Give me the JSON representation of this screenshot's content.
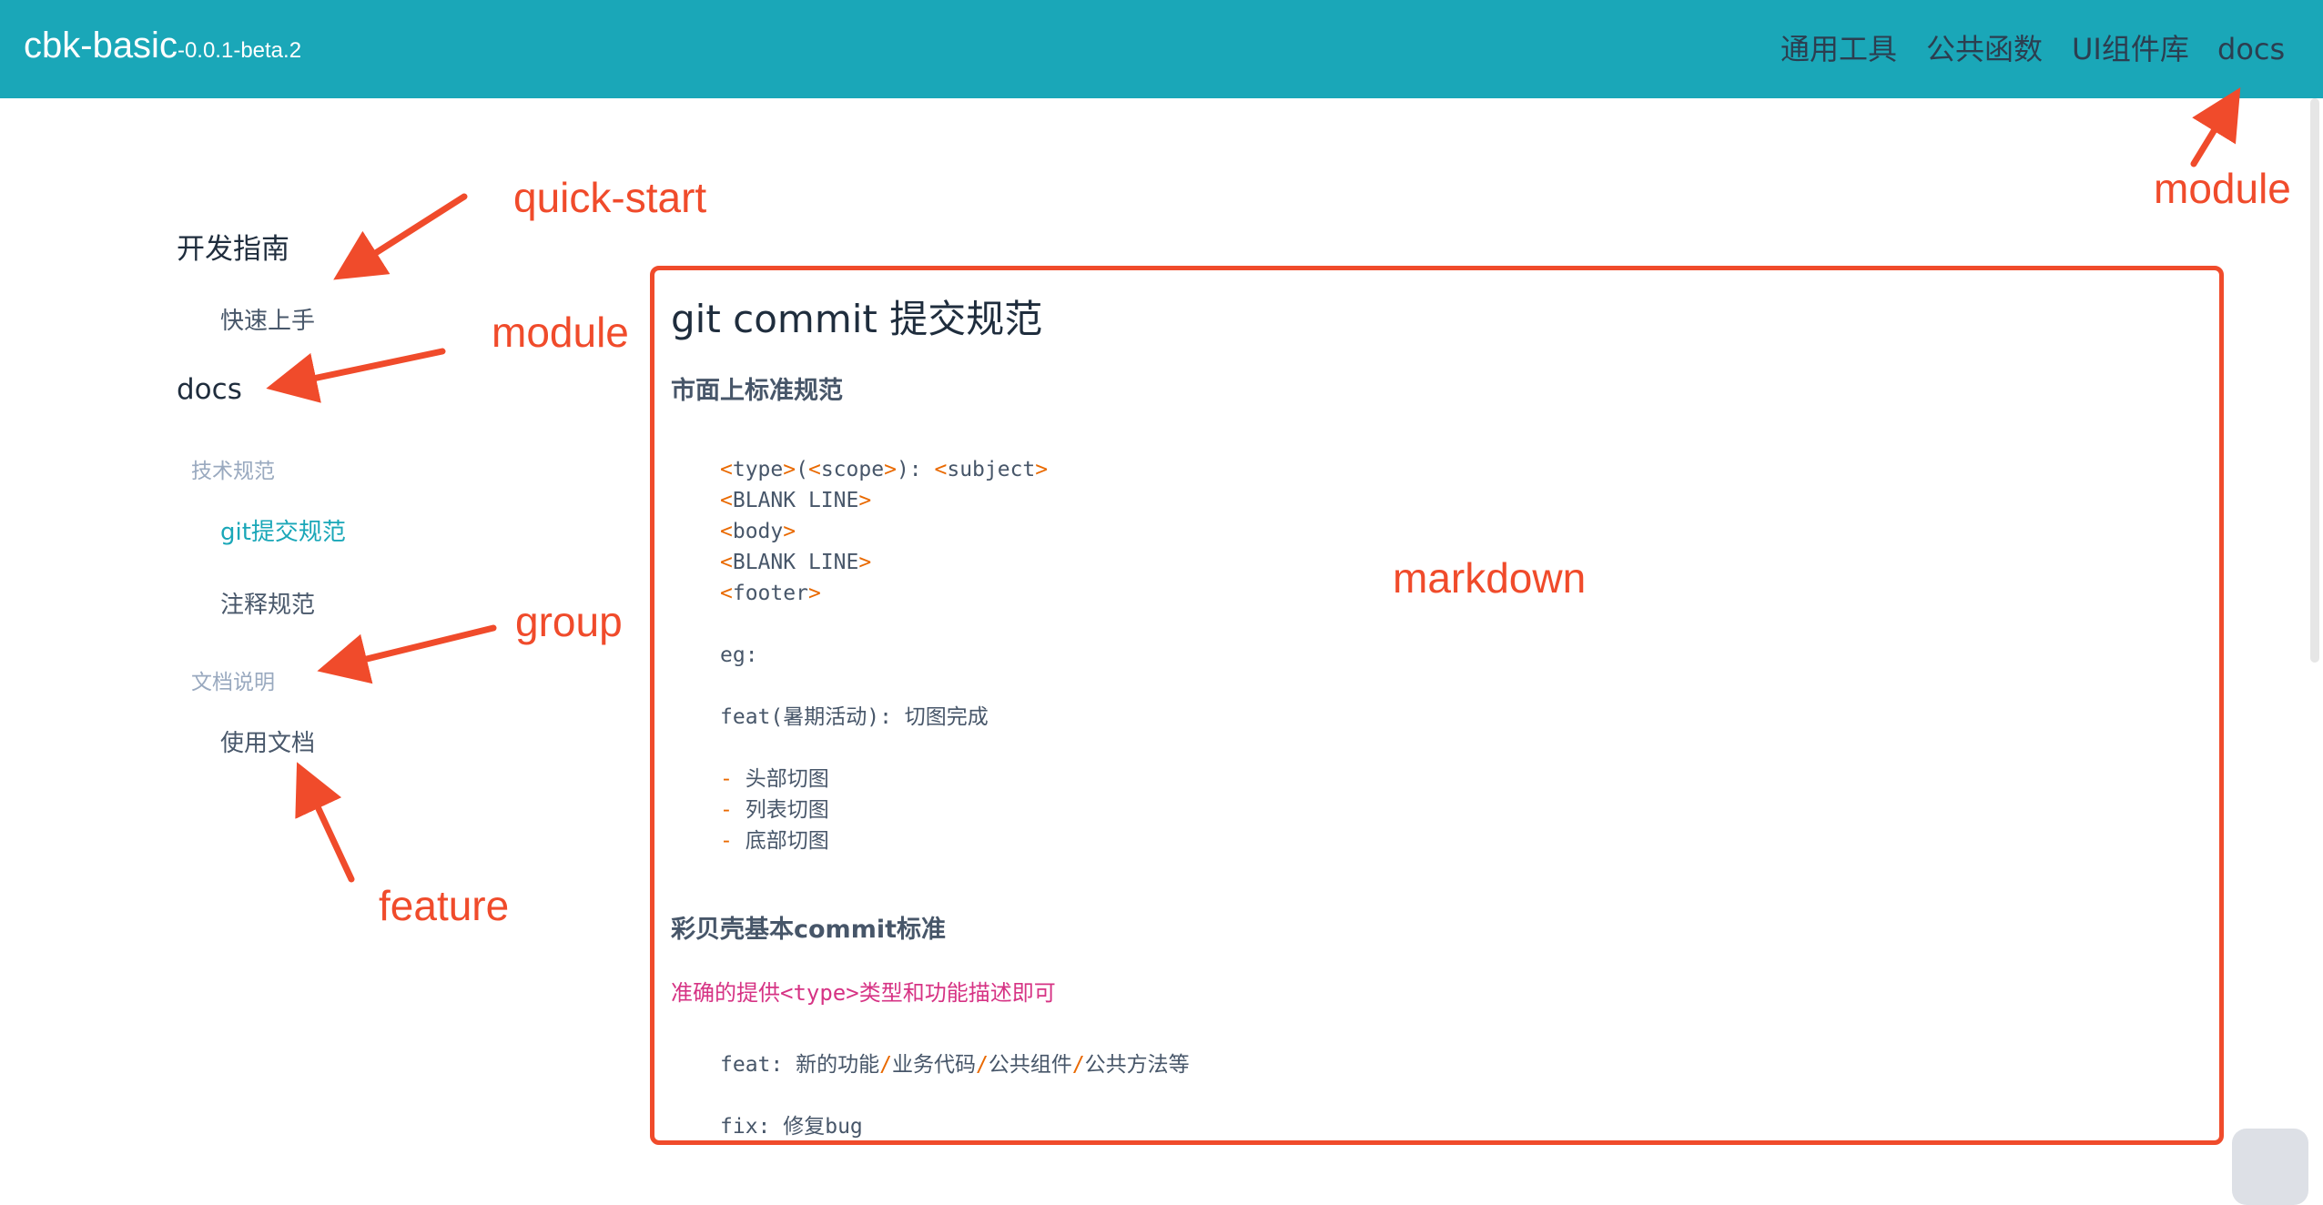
{
  "header": {
    "brand": "cbk-basic",
    "version": "-0.0.1-beta.2",
    "nav": [
      "通用工具",
      "公共函数",
      "UI组件库",
      "docs"
    ]
  },
  "sidebar": {
    "module_1": "开发指南",
    "feature_quick": "快速上手",
    "module_2": "docs",
    "group_1": "技术规范",
    "feature_git": "git提交规范",
    "feature_comment": "注释规范",
    "group_2": "文档说明",
    "feature_docs": "使用文档"
  },
  "content": {
    "title": "git commit 提交规范",
    "section_1": "市面上标准规范",
    "code_1": [
      [
        [
          "<",
          "t"
        ],
        [
          "type",
          "n"
        ],
        [
          ">",
          "t"
        ],
        [
          "(",
          "n"
        ],
        [
          "<",
          "t"
        ],
        [
          "scope",
          "n"
        ],
        [
          ">",
          "t"
        ],
        [
          "): ",
          "n"
        ],
        [
          "<",
          "t"
        ],
        [
          "subject",
          "n"
        ],
        [
          ">",
          "t"
        ]
      ],
      [
        [
          "<",
          "t"
        ],
        [
          "BLANK LINE",
          "n"
        ],
        [
          ">",
          "t"
        ]
      ],
      [
        [
          "<",
          "t"
        ],
        [
          "body",
          "n"
        ],
        [
          ">",
          "t"
        ]
      ],
      [
        [
          "<",
          "t"
        ],
        [
          "BLANK LINE",
          "n"
        ],
        [
          ">",
          "t"
        ]
      ],
      [
        [
          "<",
          "t"
        ],
        [
          "footer",
          "n"
        ],
        [
          ">",
          "t"
        ]
      ],
      [
        [
          "",
          "n"
        ]
      ],
      [
        [
          "eg:",
          "n"
        ]
      ],
      [
        [
          "",
          "n"
        ]
      ],
      [
        [
          "feat(暑期活动): 切图完成",
          "n"
        ]
      ],
      [
        [
          "",
          "n"
        ]
      ],
      [
        [
          "- ",
          "t"
        ],
        [
          "头部切图",
          "n"
        ]
      ],
      [
        [
          "- ",
          "t"
        ],
        [
          "列表切图",
          "n"
        ]
      ],
      [
        [
          "- ",
          "t"
        ],
        [
          "底部切图",
          "n"
        ]
      ]
    ],
    "section_2": "彩贝壳基本commit标准",
    "pink_prefix": "准确的提供",
    "pink_code": "<type>",
    "pink_suffix": "类型和功能描述即可",
    "code_2": [
      [
        [
          "feat: 新的功能",
          "n"
        ],
        [
          "/",
          "t"
        ],
        [
          "业务代码",
          "n"
        ],
        [
          "/",
          "t"
        ],
        [
          "公共组件",
          "n"
        ],
        [
          "/",
          "t"
        ],
        [
          "公共方法等",
          "n"
        ]
      ],
      [
        [
          "",
          "n"
        ]
      ],
      [
        [
          "fix: 修复bug",
          "n"
        ]
      ]
    ]
  },
  "annotations": {
    "quick_start": "quick-start",
    "module_left": "module",
    "module_right": "module",
    "group": "group",
    "feature": "feature",
    "markdown": "markdown"
  }
}
